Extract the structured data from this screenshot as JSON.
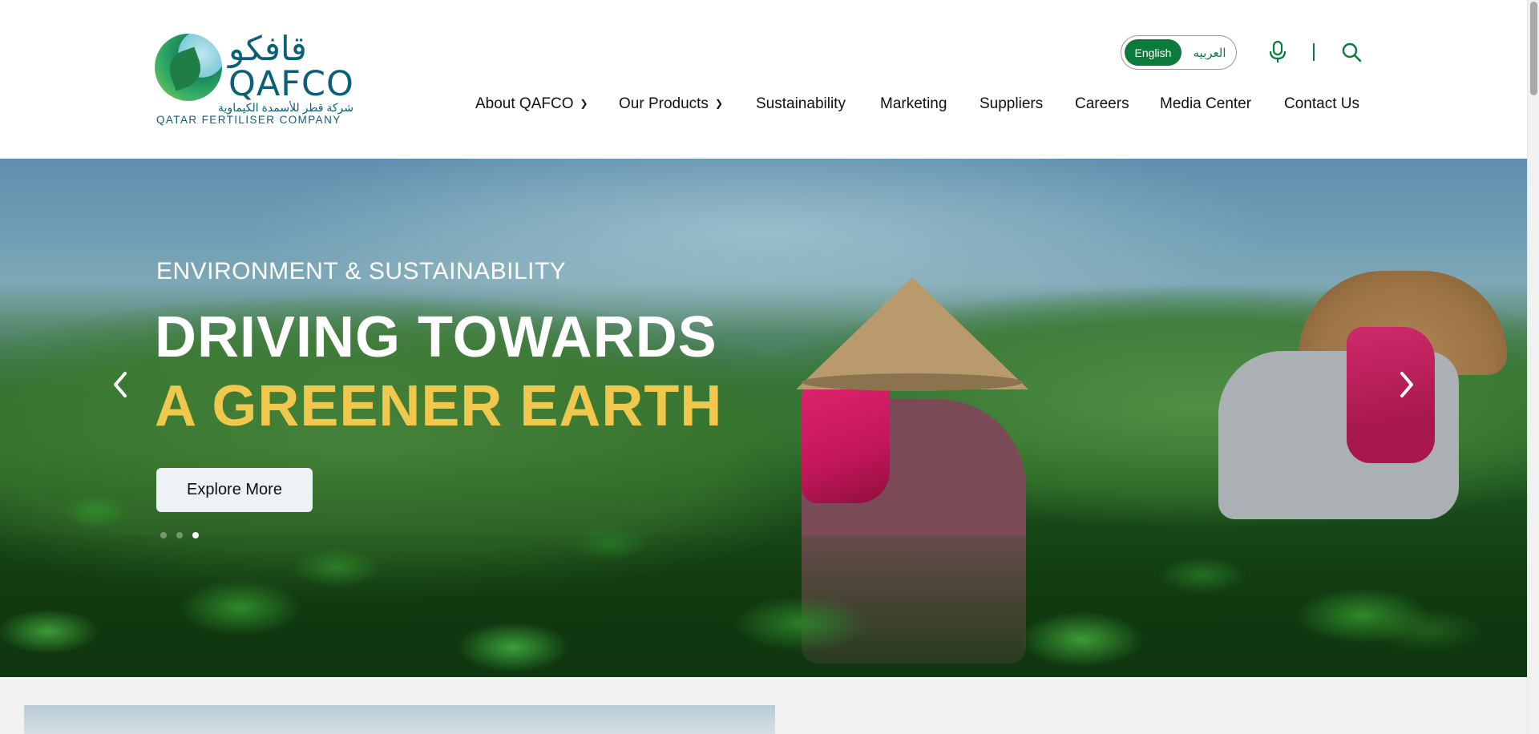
{
  "brand": {
    "logo_ar": "قافكو",
    "logo_en": "QAFCO",
    "logo_ar_sub": "شركة قطر للأسمدة الكيماوية",
    "logo_en_sub": "QATAR FERTILISER COMPANY"
  },
  "language": {
    "english": "English",
    "arabic": "العربيه",
    "active": "English"
  },
  "header_icons": {
    "voice": "microphone-icon",
    "search": "search-icon"
  },
  "nav": [
    {
      "label": "About QAFCO",
      "has_dropdown": true
    },
    {
      "label": "Our Products",
      "has_dropdown": true
    },
    {
      "label": "Sustainability",
      "has_dropdown": false
    },
    {
      "label": "Marketing",
      "has_dropdown": false
    },
    {
      "label": "Suppliers",
      "has_dropdown": false
    },
    {
      "label": "Careers",
      "has_dropdown": false
    },
    {
      "label": "Media Center",
      "has_dropdown": false
    },
    {
      "label": "Contact Us",
      "has_dropdown": false
    }
  ],
  "hero": {
    "subtitle": "ENVIRONMENT & SUSTAINABILITY",
    "title_line1": "DRIVING TOWARDS",
    "title_line2": "A GREENER EARTH",
    "cta": "Explore More",
    "slides_total": 3,
    "active_slide": 3,
    "accent_color": "#f0c84e"
  },
  "colors": {
    "brand_green": "#0b7a3b",
    "brand_teal": "#0b5f78"
  }
}
